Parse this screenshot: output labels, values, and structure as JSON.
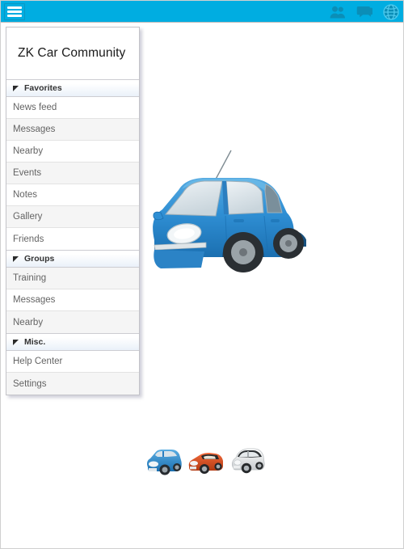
{
  "topbar": {
    "menu_icon": "hamburger-menu-icon",
    "background_color": "#00ade1",
    "icons": [
      {
        "name": "people-icon",
        "label": "Contacts"
      },
      {
        "name": "chat-bubble-icon",
        "label": "Messages"
      },
      {
        "name": "globe-icon",
        "label": "Global"
      }
    ]
  },
  "sidebar": {
    "title": "ZK Car Community",
    "groups": [
      {
        "label": "Favorites",
        "collapse_icon": "caret-icon",
        "items": [
          {
            "label": "News feed"
          },
          {
            "label": "Messages"
          },
          {
            "label": "Nearby"
          },
          {
            "label": "Events"
          },
          {
            "label": "Notes"
          },
          {
            "label": "Gallery"
          },
          {
            "label": "Friends"
          }
        ]
      },
      {
        "label": "Groups",
        "collapse_icon": "caret-icon",
        "items": [
          {
            "label": "Training"
          },
          {
            "label": "Messages"
          },
          {
            "label": "Nearby"
          }
        ]
      },
      {
        "label": "Misc.",
        "collapse_icon": "caret-icon",
        "items": [
          {
            "label": "Help Center"
          },
          {
            "label": "Settings"
          }
        ]
      }
    ]
  },
  "main": {
    "hero": {
      "name": "blue-hatchback-car-photo",
      "body_color": "#2f8fd4",
      "body_color_dark": "#1b6fb0",
      "glass_color": "#dfe6ea"
    },
    "thumbnails": [
      {
        "name": "thumbnail-blue-hatchback",
        "body_color": "#2f8fd4",
        "body_color_dark": "#1b6fb0"
      },
      {
        "name": "thumbnail-orange-convertible",
        "body_color": "#e8521f",
        "body_color_dark": "#b23a12"
      },
      {
        "name": "thumbnail-white-classic-car",
        "body_color": "#f2f2f2",
        "body_color_dark": "#c8c8c8"
      }
    ]
  }
}
